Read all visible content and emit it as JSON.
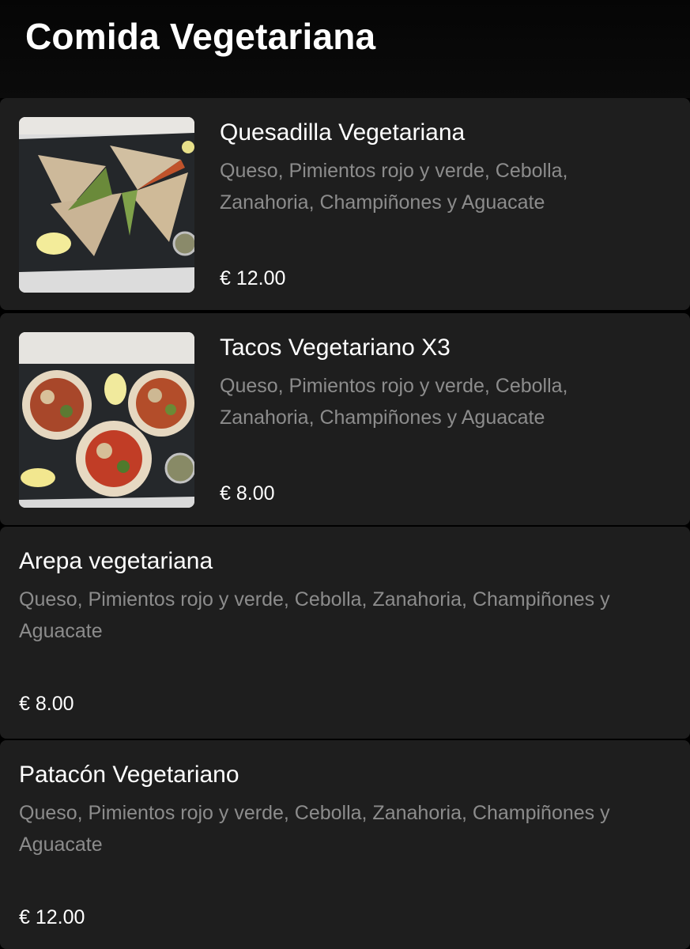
{
  "header": {
    "title": "Comida Vegetariana"
  },
  "items": [
    {
      "name": "Quesadilla Vegetariana",
      "description": "Queso, Pimientos rojo y verde, Cebolla, Zanahoria, Champiñones y Aguacate",
      "price": "€ 12.00",
      "image": "quesadilla-photo"
    },
    {
      "name": "Tacos Vegetariano X3",
      "description": "Queso, Pimientos rojo y verde, Cebolla, Zanahoria, Champiñones y Aguacate",
      "price": "€ 8.00",
      "image": "tacos-photo"
    },
    {
      "name": "Arepa vegetariana",
      "description": "Queso, Pimientos rojo y verde, Cebolla, Zanahoria, Champiñones y Aguacate",
      "price": "€ 8.00"
    },
    {
      "name": "Patacón Vegetariano",
      "description": "Queso, Pimientos rojo y verde, Cebolla, Zanahoria, Champiñones y Aguacate",
      "price": "€ 12.00"
    }
  ],
  "colors": {
    "background": "#000000",
    "card": "#1e1e1e",
    "title_text": "#ffffff",
    "description_text": "#8c8c8c"
  }
}
